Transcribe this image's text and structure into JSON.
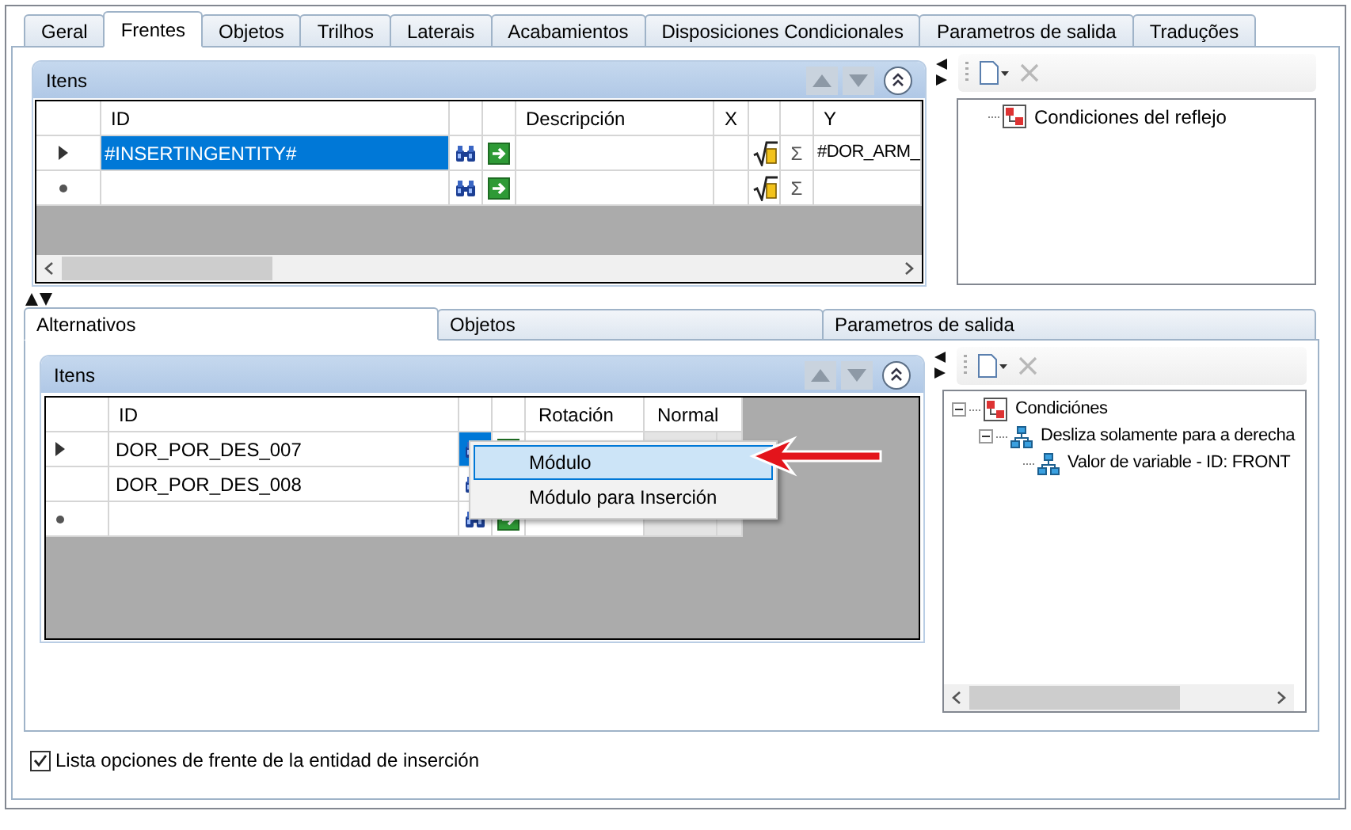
{
  "tabs": [
    {
      "label": "Geral",
      "selected": false
    },
    {
      "label": "Frentes",
      "selected": true
    },
    {
      "label": "Objetos",
      "selected": false
    },
    {
      "label": "Trilhos",
      "selected": false
    },
    {
      "label": "Laterais",
      "selected": false
    },
    {
      "label": "Acabamientos",
      "selected": false
    },
    {
      "label": "Disposiciones Condicionales",
      "selected": false
    },
    {
      "label": "Parametros de salida",
      "selected": false
    },
    {
      "label": "Traduções",
      "selected": false
    }
  ],
  "top_grid": {
    "title": "Itens",
    "columns": [
      "ID",
      "Descripción",
      "X",
      "Y"
    ],
    "rows": [
      {
        "current": true,
        "new_entry": false,
        "id": "#INSERTINGENTITY#",
        "selected": true,
        "sum_symbol": "Σ",
        "y": "#DOR_ARM_"
      },
      {
        "current": false,
        "new_entry": true,
        "selected": false,
        "sum_symbol": "Σ"
      }
    ]
  },
  "top_tree": {
    "items": [
      {
        "label": "Condiciones del reflejo",
        "kind": "condition"
      }
    ]
  },
  "sub_tabs": [
    {
      "label": "Alternativos",
      "selected": true
    },
    {
      "label": "Objetos",
      "selected": false
    },
    {
      "label": "Parametros de salida",
      "selected": false
    }
  ],
  "bottom_grid": {
    "title": "Itens",
    "columns": [
      "ID",
      "Rotación",
      "Normal"
    ],
    "rows": [
      {
        "current": true,
        "new_entry": false,
        "id": "DOR_POR_DES_007",
        "button_selected": true
      },
      {
        "current": false,
        "new_entry": false,
        "id": "DOR_POR_DES_008",
        "button_selected": false
      },
      {
        "current": false,
        "new_entry": true,
        "button_selected": false
      }
    ]
  },
  "context_menu": {
    "items": [
      {
        "label": "Módulo",
        "selected": true
      },
      {
        "label": "Módulo para Inserción",
        "selected": false
      }
    ]
  },
  "bottom_tree": {
    "items": [
      {
        "label": "Condiciónes",
        "kind": "condition",
        "expanded": true,
        "children": [
          {
            "label": "Desliza solamente para a derecha",
            "kind": "group",
            "expanded": true,
            "children": [
              {
                "label": "Valor de variable - ID: FRONT",
                "kind": "group"
              }
            ]
          }
        ]
      }
    ]
  },
  "checkbox": {
    "label": "Lista opciones de frente de la entidad de inserción",
    "checked": true
  }
}
